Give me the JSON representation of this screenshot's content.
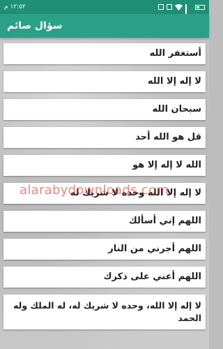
{
  "status_bar": {
    "time": "١٢:٥٢ م",
    "battery_icon": "battery-icon",
    "wifi_icon": "wifi-icon",
    "signal_icon": "signal-icon"
  },
  "app_bar": {
    "title": "سؤال صائم"
  },
  "items": [
    {
      "label": "أستغفر الله"
    },
    {
      "label": "لا إله إلا الله"
    },
    {
      "label": "سبحان الله"
    },
    {
      "label": "قل هو الله أحد"
    },
    {
      "label": "الله لا إله إلا هو"
    },
    {
      "label": "لا إله إلا الله وحده لا شريك له"
    },
    {
      "label": "اللهم إني أسألك"
    },
    {
      "label": "اللهم أجرني من النار"
    },
    {
      "label": "اللهم أعني على ذكرك"
    },
    {
      "label": "لا إله إلا الله، وحده لا شريك له، له الملك وله الحمد"
    }
  ],
  "watermark": "alarabydownloads.com"
}
